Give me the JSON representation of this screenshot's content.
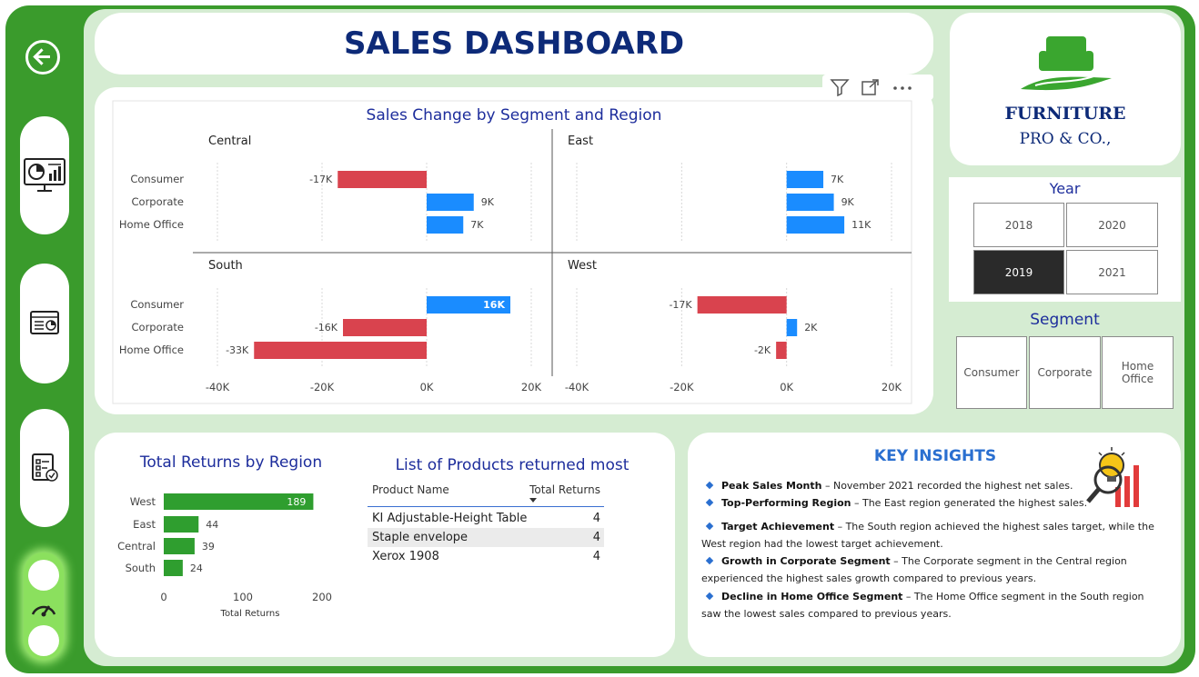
{
  "header": {
    "title": "SALES DASHBOARD"
  },
  "toolbar": {
    "icons": [
      "filter-icon",
      "focus-mode-icon",
      "more-options-icon"
    ]
  },
  "sidebar": {
    "icons": [
      "back-arrow-icon",
      "dashboard-monitor-icon",
      "report-icon",
      "checklist-icon",
      "gauge-icon"
    ]
  },
  "logo": {
    "line1": "FURNITURE",
    "line2": "PRO & CO.,"
  },
  "year_filter": {
    "title": "Year",
    "options": [
      "2018",
      "2020",
      "2019",
      "2021"
    ],
    "selected": "2019"
  },
  "segment_filter": {
    "title": "Segment",
    "options": [
      "Consumer",
      "Corporate",
      "Home Office"
    ]
  },
  "colors": {
    "negative": "#d9434e",
    "positive": "#1a8cff",
    "returns_bar": "#2f9e2f",
    "brand_green": "#3a9b2c",
    "title_blue": "#1d2d9c"
  },
  "chart_data": [
    {
      "type": "bar",
      "title": "Sales Change by Segment and Region",
      "orientation": "horizontal",
      "categories": [
        "Consumer",
        "Corporate",
        "Home Office"
      ],
      "panels": [
        {
          "name": "Central",
          "values": [
            -17,
            9,
            7
          ],
          "labels": [
            "-17K",
            "9K",
            "7K"
          ]
        },
        {
          "name": "East",
          "values": [
            7,
            9,
            11
          ],
          "labels": [
            "7K",
            "9K",
            "11K"
          ]
        },
        {
          "name": "South",
          "values": [
            16,
            -16,
            -33
          ],
          "labels": [
            "16K",
            "-16K",
            "-33K"
          ]
        },
        {
          "name": "West",
          "values": [
            -17,
            2,
            -2
          ],
          "labels": [
            "-17K",
            "2K",
            "-2K"
          ]
        }
      ],
      "xticks": [
        "-40K",
        "-20K",
        "0K",
        "20K"
      ],
      "xlim": [
        -40,
        20
      ]
    },
    {
      "type": "bar",
      "title": "Total Returns by Region",
      "orientation": "horizontal",
      "categories": [
        "West",
        "East",
        "Central",
        "South"
      ],
      "values": [
        189,
        44,
        39,
        24
      ],
      "value_labels": [
        "189",
        "44",
        "39",
        "24"
      ],
      "xlabel": "Total Returns",
      "xticks": [
        "0",
        "100",
        "200"
      ],
      "xlim": [
        0,
        200
      ]
    }
  ],
  "products_table": {
    "title": "List of Products returned most",
    "headers": [
      "Product Name",
      "Total Returns"
    ],
    "rows": [
      {
        "name": "KI Adjustable-Height Table",
        "returns": "4"
      },
      {
        "name": "Staple envelope",
        "returns": "4"
      },
      {
        "name": "Xerox 1908",
        "returns": "4"
      }
    ]
  },
  "insights": {
    "title": "KEY INSIGHTS",
    "items": [
      {
        "label": "Peak Sales Month",
        "text": " – November 2021 recorded the highest net sales."
      },
      {
        "label": "Top-Performing Region",
        "text": " – The East region generated the highest sales."
      },
      {
        "label": "Target Achievement",
        "text": " – The South region achieved the highest sales target, while the West region had the lowest target achievement."
      },
      {
        "label": "Growth in Corporate Segment",
        "text": " – The Corporate segment in the Central region experienced the highest sales growth compared to previous years."
      },
      {
        "label": "Decline in Home Office Segment",
        "text": " – The Home Office segment in the South region saw the lowest sales compared to previous years."
      }
    ]
  }
}
